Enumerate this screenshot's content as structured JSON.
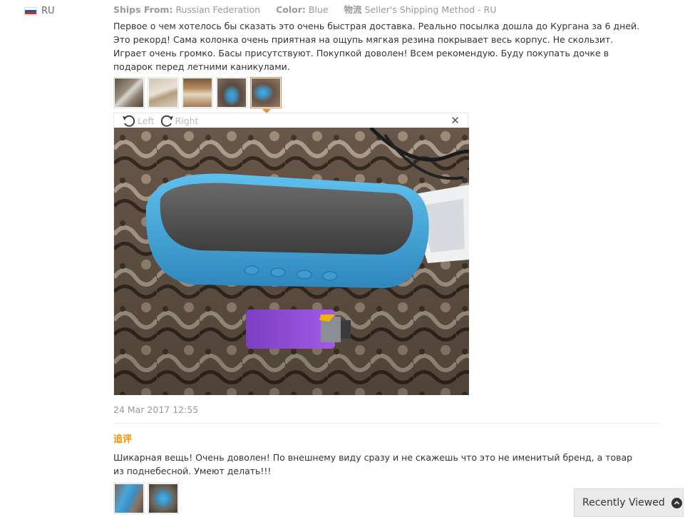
{
  "reviewer": {
    "country": "RU",
    "flag_colors": [
      "#ffffff",
      "#1c57a5",
      "#d52b1e"
    ]
  },
  "meta": {
    "ships_from_label": "Ships From:",
    "ships_from_value": "Russian Federation",
    "color_label": "Color:",
    "color_value": "Blue",
    "shipping_label": "物流",
    "shipping_value": "Seller's Shipping Method - RU"
  },
  "review": {
    "text": "Первое о чем хотелось бы сказать это очень быстрая доставка. Реально посылка дошла до Кургана за 6 дней. Это рекорд! Сама колонка очень приятная на ощупь мягкая резина покрывает весь корпус. Не скользит. Играет очень громко. Басы присутствуют. Покупкой доволен! Всем рекомендую. Буду покупать дочке в подарок перед летними каникулами.",
    "thumbnail_count": 5,
    "active_thumbnail": 5,
    "date": "24 Mar 2017 12:55"
  },
  "viewer": {
    "rotate_left_label": "Left",
    "rotate_right_label": "Right",
    "close_icon": "close-icon"
  },
  "followup": {
    "label": "追评",
    "text": "Шикарная вещь! Очень доволен! По внешнему виду сразу и не скажешь что это не именитый бренд, а товар из поднебесной. Умеют делать!!!",
    "thumbnail_count": 2
  },
  "recently_viewed": {
    "label": "Recently Viewed",
    "icon": "chevron-up-circle-icon"
  },
  "colors": {
    "accent_orange": "#f39500",
    "active_border": "#f1883b",
    "muted_text": "#999999"
  }
}
